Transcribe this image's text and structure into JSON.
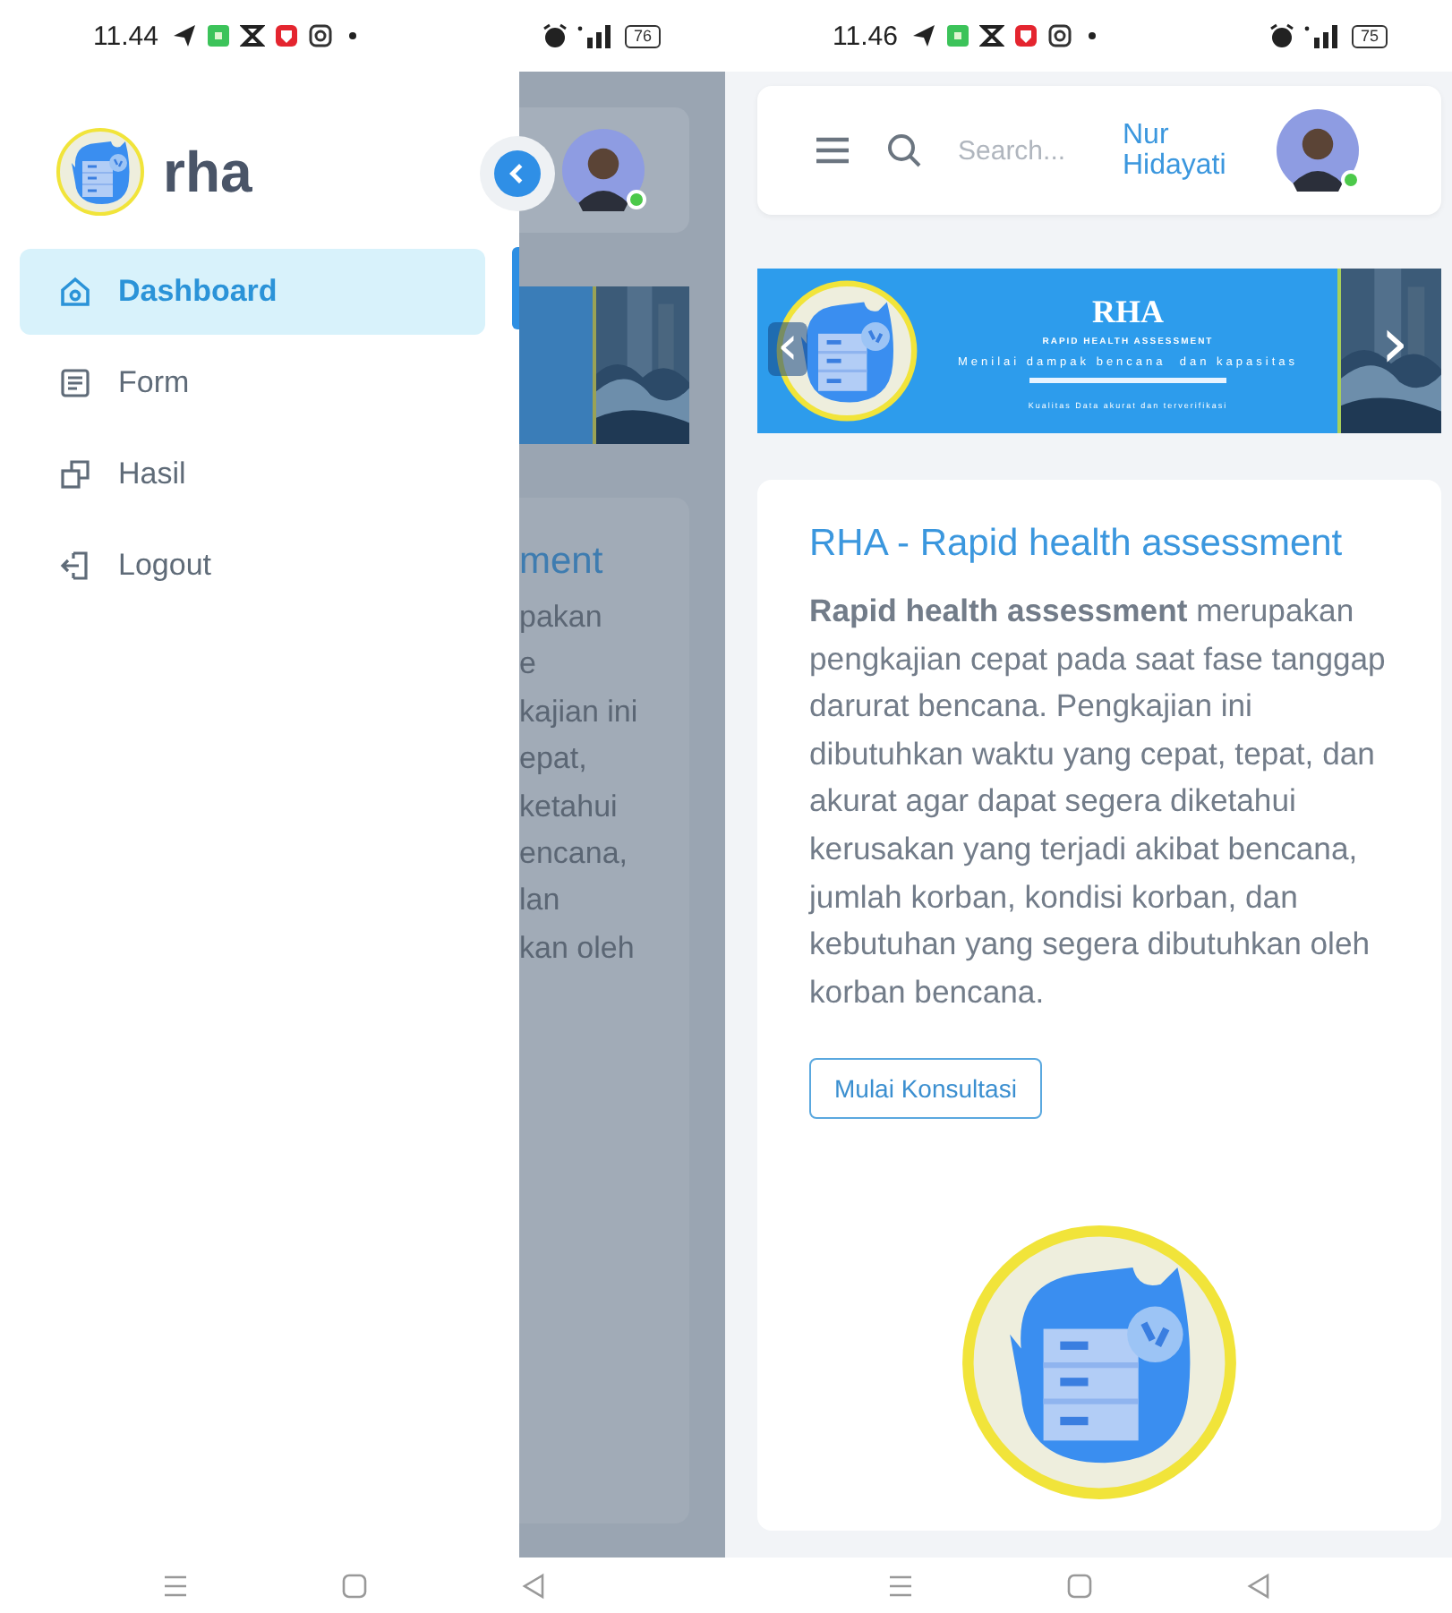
{
  "left_screen": {
    "status_bar": {
      "time": "11.44",
      "battery": "76"
    },
    "sidebar": {
      "brand": "rha",
      "items": [
        {
          "label": "Dashboard",
          "selected": true
        },
        {
          "label": "Form",
          "selected": false
        },
        {
          "label": "Hasil",
          "selected": false
        },
        {
          "label": "Logout",
          "selected": false
        }
      ]
    },
    "background_page": {
      "title_fragment": "ment",
      "text_fragments": [
        "pakan",
        "e",
        "kajian ini",
        "epat,",
        "ketahui",
        "encana,",
        "lan",
        "kan oleh"
      ]
    }
  },
  "right_screen": {
    "status_bar": {
      "time": "11.46",
      "battery": "75"
    },
    "header": {
      "search": {
        "placeholder": "Search..."
      },
      "user_name": "Nur Hidayati"
    },
    "banner": {
      "prev": "‹",
      "next": "›",
      "title": "RHA",
      "subtitle": "RAPID HEALTH ASSESSMENT",
      "tagline": "Menilai dampak bencana  dan kapasitas",
      "footer": "Kualitas Data akurat dan terverifikasi"
    },
    "card": {
      "title": "RHA - Rapid health assessment",
      "body": "**Rapid health assessment** merupakan pengkajian cepat pada saat fase tanggap darurat bencana. Pengkajian ini dibutuhkan waktu yang cepat, tepat, dan akurat agar dapat segera diketahui kerusakan yang terjadi akibat bencana, jumlah korban, kondisi korban, dan kebutuhan yang segera dibutuhkan oleh korban bencana.",
      "button": "Mulai Konsultasi"
    }
  }
}
